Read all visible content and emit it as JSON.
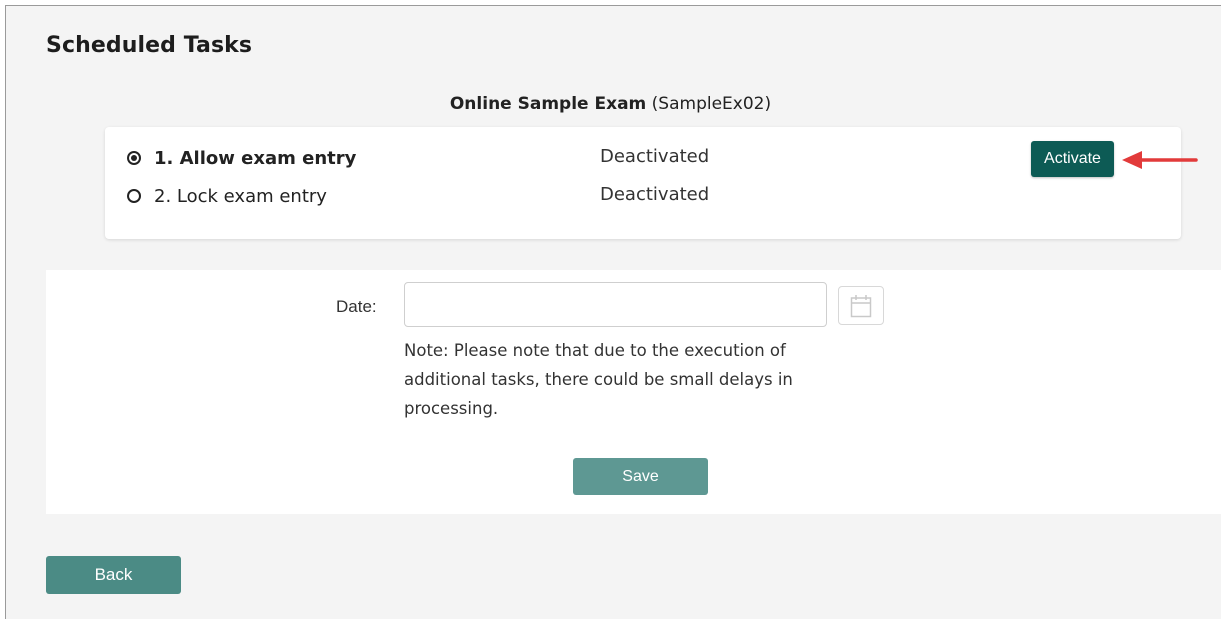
{
  "page": {
    "title": "Scheduled Tasks"
  },
  "exam": {
    "name": "Online Sample Exam",
    "code": "(SampleEx02)"
  },
  "tasks": [
    {
      "label": "1. Allow exam entry",
      "status": "Deactivated",
      "selected": true
    },
    {
      "label": "2. Lock exam entry",
      "status": "Deactivated",
      "selected": false
    }
  ],
  "actions": {
    "activate_label": "Activate",
    "save_label": "Save",
    "back_label": "Back"
  },
  "schedule": {
    "date_label": "Date:",
    "date_value": "",
    "note": "Note: Please note that due to the execution of additional tasks, there could be small delays in processing."
  },
  "icons": {
    "calendar": "calendar-icon",
    "arrow": "red-arrow-icon",
    "radio_checked": "radio-checked-icon",
    "radio_unchecked": "radio-unchecked-icon"
  },
  "colors": {
    "primary": "#0d5b55",
    "primary_muted": "#5e9893",
    "back_button": "#4b8b85",
    "arrow": "#e23a3a",
    "background": "#f4f4f4"
  }
}
